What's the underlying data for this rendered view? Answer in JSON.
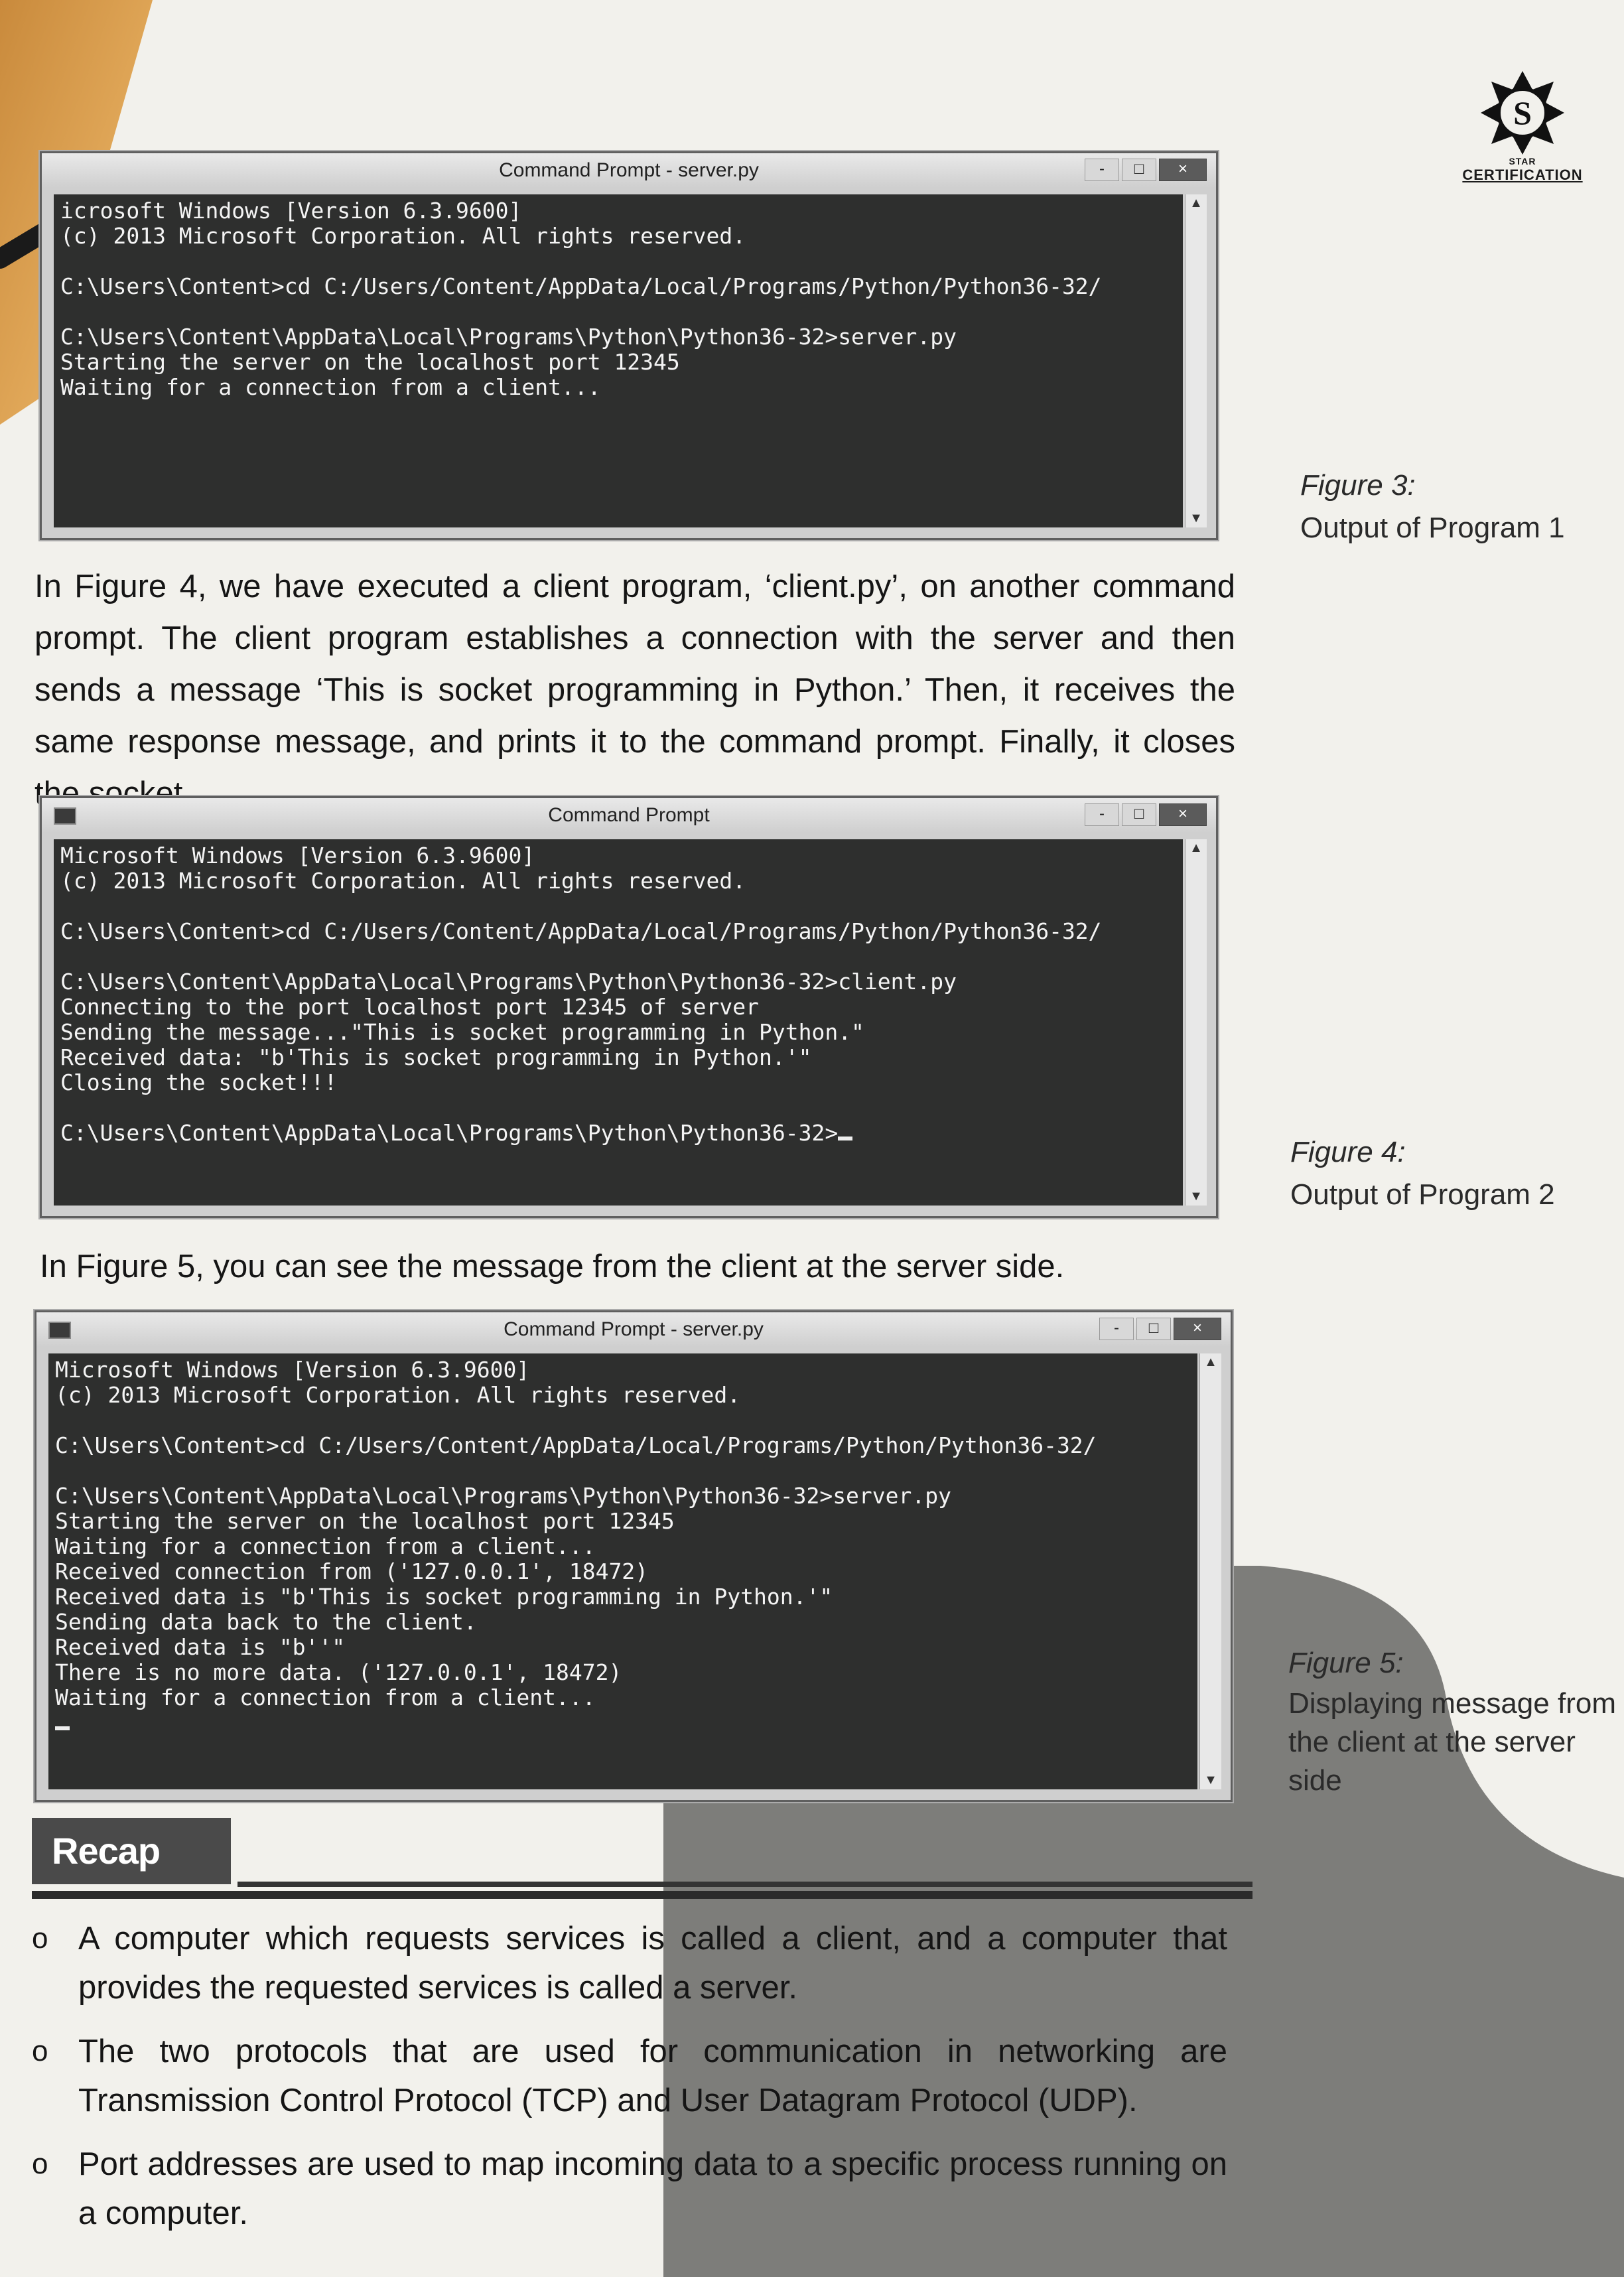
{
  "logo": {
    "letter": "S",
    "tiny_text": "STAR",
    "word": "CERTIFICATION"
  },
  "figure3": {
    "window_title": "Command Prompt - server.py",
    "buttons": {
      "minimize": "-",
      "maximize": "□",
      "close": "×"
    },
    "lines": [
      "icrosoft Windows [Version 6.3.9600]",
      "(c) 2013 Microsoft Corporation. All rights reserved.",
      "",
      "C:\\Users\\Content>cd C:/Users/Content/AppData/Local/Programs/Python/Python36-32/",
      "",
      "C:\\Users\\Content\\AppData\\Local\\Programs\\Python\\Python36-32>server.py",
      "Starting the server on the localhost port 12345",
      "Waiting for a connection from a client..."
    ],
    "caption_label": "Figure 3:",
    "caption_text": "Output of Program 1"
  },
  "paragraph1": "In Figure 4, we have executed a client program, ‘client.py’, on another command prompt. The client program establishes a connection with the server and then sends a message ‘This is socket programming in Python.’ Then, it receives the same response message, and prints it to the command prompt. Finally, it closes the socket.",
  "figure4": {
    "window_title": "Command Prompt",
    "buttons": {
      "minimize": "-",
      "maximize": "□",
      "close": "×"
    },
    "lines": [
      "Microsoft Windows [Version 6.3.9600]",
      "(c) 2013 Microsoft Corporation. All rights reserved.",
      "",
      "C:\\Users\\Content>cd C:/Users/Content/AppData/Local/Programs/Python/Python36-32/",
      "",
      "C:\\Users\\Content\\AppData\\Local\\Programs\\Python\\Python36-32>client.py",
      "Connecting to the port localhost port 12345 of server",
      "Sending the message...\"This is socket programming in Python.\"",
      "Received data: \"b'This is socket programming in Python.'\"",
      "Closing the socket!!!",
      "",
      "C:\\Users\\Content\\AppData\\Local\\Programs\\Python\\Python36-32>"
    ],
    "caption_label": "Figure 4:",
    "caption_text": "Output of Program 2"
  },
  "paragraph2": "In Figure 5, you can see the message from the client at the server side.",
  "figure5": {
    "window_title": "Command Prompt - server.py",
    "buttons": {
      "minimize": "-",
      "maximize": "□",
      "close": "×"
    },
    "lines": [
      "Microsoft Windows [Version 6.3.9600]",
      "(c) 2013 Microsoft Corporation. All rights reserved.",
      "",
      "C:\\Users\\Content>cd C:/Users/Content/AppData/Local/Programs/Python/Python36-32/",
      "",
      "C:\\Users\\Content\\AppData\\Local\\Programs\\Python\\Python36-32>server.py",
      "Starting the server on the localhost port 12345",
      "Waiting for a connection from a client...",
      "Received connection from ('127.0.0.1', 18472)",
      "Received data is \"b'This is socket programming in Python.'\"",
      "Sending data back to the client.",
      "Received data is \"b''\"",
      "There is no more data. ('127.0.0.1', 18472)",
      "Waiting for a connection from a client..."
    ],
    "caption_label": "Figure 5:",
    "caption_text": "Displaying message from the client at the server side"
  },
  "recap": {
    "heading": "Recap",
    "bullet_mark": "o",
    "items": [
      "A computer which requests services is called a client, and a computer that provides the requested services is called a server.",
      "The two protocols that are used for communication in networking are Transmission Control Protocol (TCP) and User Datagram Protocol (UDP).",
      "Port addresses are used to map incoming data to a specific process running on a computer."
    ]
  }
}
